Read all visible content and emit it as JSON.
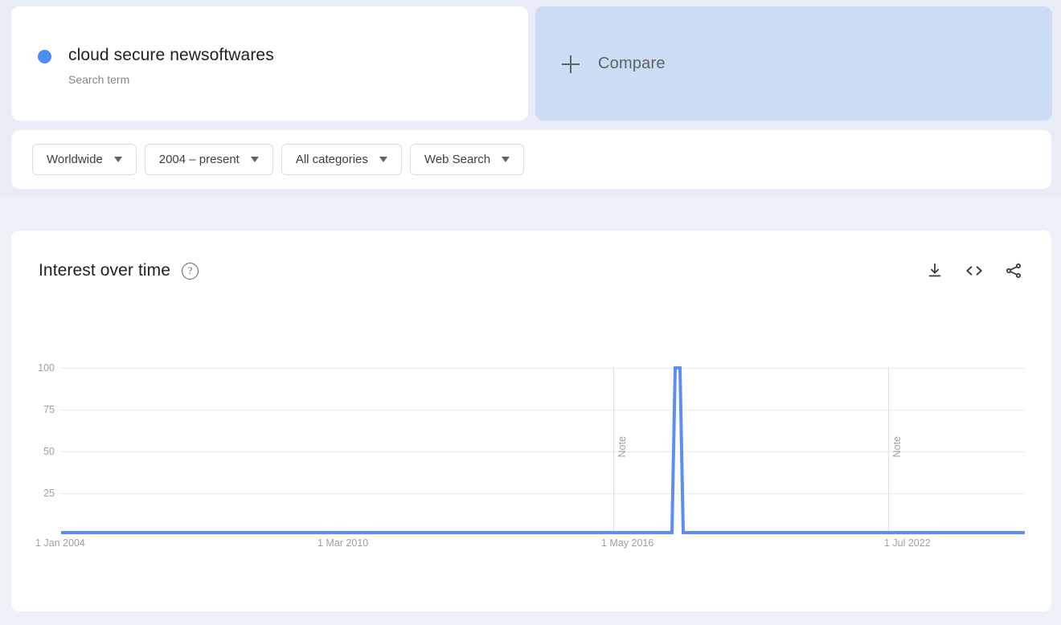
{
  "page": {
    "background": "#eef1f8",
    "top_band_background": "#e8ecf7",
    "accent_color": "#4c8df5"
  },
  "term_card": {
    "title": "cloud secure newsoftwares",
    "subtitle": "Search term",
    "dot_color": "#4c8df5"
  },
  "compare_card": {
    "label": "Compare",
    "icon": "plus-icon",
    "background": "#ccdcf5"
  },
  "filters": [
    {
      "name": "location",
      "label": "Worldwide",
      "icon": "chevron-down-icon"
    },
    {
      "name": "time-range",
      "label": "2004 – present",
      "icon": "chevron-down-icon"
    },
    {
      "name": "category",
      "label": "All categories",
      "icon": "chevron-down-icon"
    },
    {
      "name": "search-type",
      "label": "Web Search",
      "icon": "chevron-down-icon"
    }
  ],
  "interest_over_time": {
    "title": "Interest over time",
    "help_glyph": "?",
    "actions": [
      {
        "name": "download-icon",
        "label": "Download"
      },
      {
        "name": "embed-code-icon",
        "label": "Embed"
      },
      {
        "name": "share-icon",
        "label": "Share"
      }
    ]
  },
  "chart_data": {
    "type": "line",
    "title": "Interest over time",
    "xlabel": "",
    "ylabel": "",
    "ylim": [
      0,
      100
    ],
    "yticks": [
      100,
      75,
      50,
      25
    ],
    "ytick_labels": [
      "100",
      "75",
      "50",
      "25"
    ],
    "xticks": [
      "1 Jan 2004",
      "1 Mar 2010",
      "1 May 2016",
      "1 Jul 2022"
    ],
    "grid": true,
    "legend_position": "none",
    "line_color": "#5c8ef5",
    "series": [
      {
        "name": "cloud secure newsoftwares",
        "color": "#5c8ef5",
        "values": [
          0,
          0,
          0,
          0,
          0,
          0,
          0,
          0,
          0,
          0,
          0,
          0,
          0,
          0,
          0,
          0,
          0,
          0,
          0,
          0,
          0,
          0,
          0,
          0,
          100,
          0,
          0,
          0,
          0,
          0,
          0,
          0,
          0,
          0,
          0,
          0,
          0,
          0,
          0,
          0
        ]
      }
    ],
    "annotations": [
      {
        "label": "Note",
        "x_fraction": 0.575,
        "orientation": "vertical"
      },
      {
        "label": "Note",
        "x_fraction": 0.861,
        "orientation": "vertical"
      }
    ],
    "peak": {
      "label": "100",
      "value": 100,
      "x_fraction": 0.642
    }
  }
}
